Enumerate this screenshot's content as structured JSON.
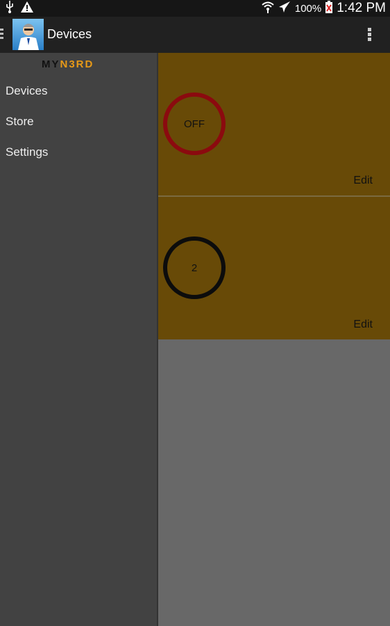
{
  "status_bar": {
    "left_icons": [
      "usb-icon",
      "warning-icon"
    ],
    "right_icons": [
      "wifi-icon",
      "airplane-mode-icon",
      "battery-icon"
    ],
    "battery_percent": "100%",
    "time": "1:42 PM"
  },
  "action_bar": {
    "title": "Devices",
    "app_icon": "app-avatar-icon",
    "overflow_icon": "overflow-menu-icon"
  },
  "drawer": {
    "logo": {
      "part1": "MY",
      "part2": "N3RD"
    },
    "items": [
      {
        "label": "Devices"
      },
      {
        "label": "Store"
      },
      {
        "label": "Settings"
      }
    ]
  },
  "devices": [
    {
      "status": "OFF",
      "ring_color": "#8b0a0f",
      "edit_label": "Edit"
    },
    {
      "status": "2",
      "ring_color": "#0c0c0c",
      "edit_label": "Edit"
    }
  ],
  "colors": {
    "card_bg": "#684a07",
    "logo_accent": "#e89a17",
    "drawer_bg": "#424242"
  }
}
